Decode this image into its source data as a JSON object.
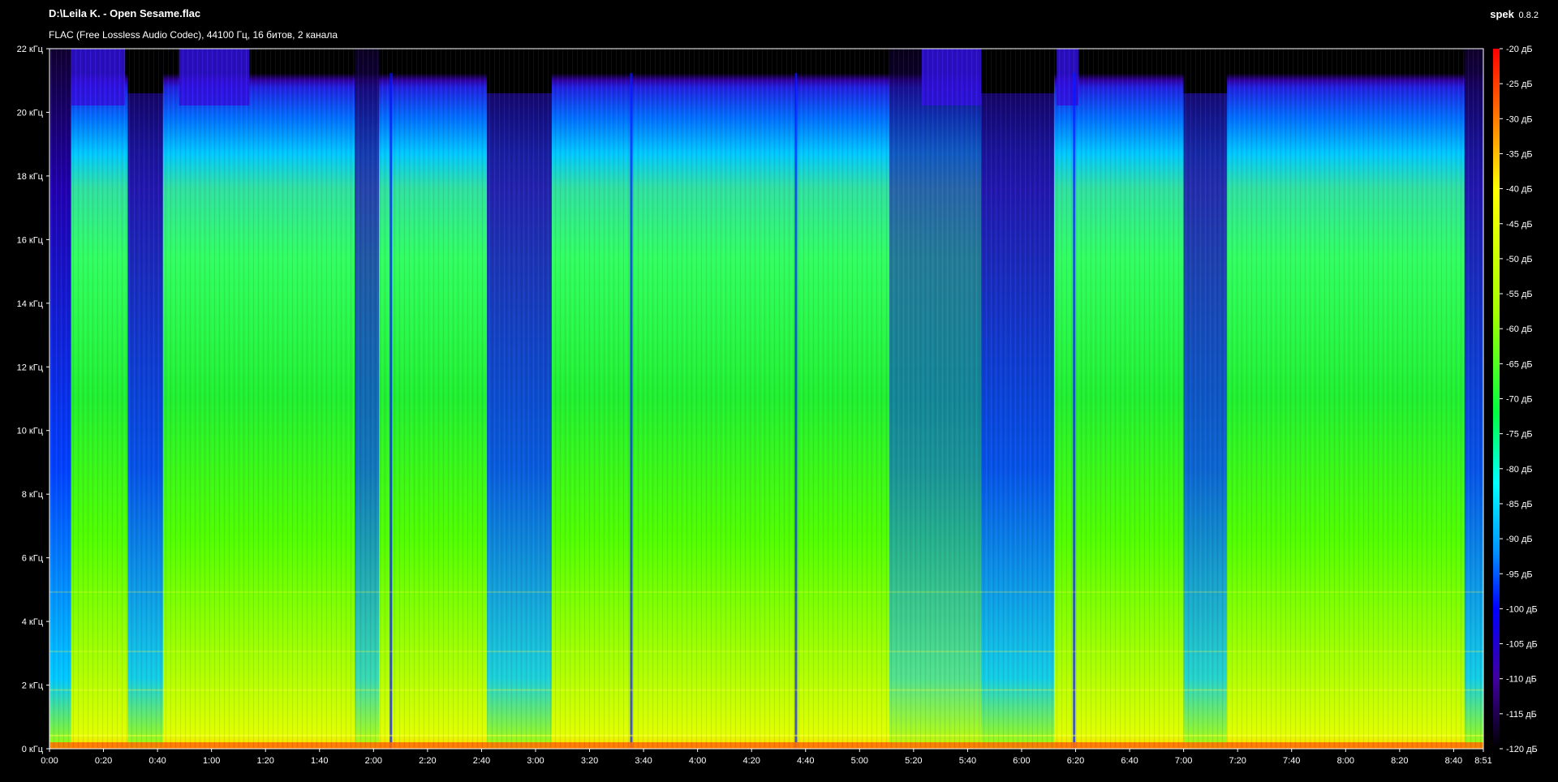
{
  "header": {
    "file_title": "D:\\Leila K. - Open Sesame.flac",
    "file_info": "FLAC (Free Lossless Audio Codec), 44100 Гц, 16 битов, 2 канала",
    "app_name": "spek",
    "app_version": "0.8.2"
  },
  "spectrogram": {
    "frequency_axis_labels": [
      "22 кГц",
      "20 кГц",
      "18 кГц",
      "16 кГц",
      "14 кГц",
      "12 кГц",
      "10 кГц",
      "8 кГц",
      "6 кГц",
      "4 кГц",
      "2 кГц",
      "0 кГц"
    ],
    "time_axis_labels": [
      "0:00",
      "0:20",
      "0:40",
      "1:00",
      "1:20",
      "1:40",
      "2:00",
      "2:20",
      "2:40",
      "3:00",
      "3:20",
      "3:40",
      "4:00",
      "4:20",
      "4:40",
      "5:00",
      "5:20",
      "5:40",
      "6:00",
      "6:20",
      "6:40",
      "7:00",
      "7:20",
      "7:40",
      "8:00",
      "8:20",
      "8:40",
      "8:51"
    ],
    "time_tick_seconds": [
      0,
      20,
      40,
      60,
      80,
      100,
      120,
      140,
      160,
      180,
      200,
      220,
      240,
      260,
      280,
      300,
      320,
      340,
      360,
      380,
      400,
      420,
      440,
      460,
      480,
      500,
      520,
      531
    ],
    "duration_seconds": 531,
    "max_frequency_khz": 22,
    "colors": {
      "background": "#000000",
      "axis": "#ffffff",
      "palette": [
        "#000000",
        "#1a0040",
        "#3a00b0",
        "#0000ff",
        "#0090ff",
        "#00ffff",
        "#00ff60",
        "#60ff00",
        "#c8ff00",
        "#ffff00",
        "#ff8000",
        "#ff0000"
      ]
    }
  },
  "legend": {
    "db_labels": [
      "-20 дБ",
      "-25 дБ",
      "-30 дБ",
      "-35 дБ",
      "-40 дБ",
      "-45 дБ",
      "-50 дБ",
      "-55 дБ",
      "-60 дБ",
      "-65 дБ",
      "-70 дБ",
      "-75 дБ",
      "-80 дБ",
      "-85 дБ",
      "-90 дБ",
      "-95 дБ",
      "-100 дБ",
      "-105 дБ",
      "-110 дБ",
      "-115 дБ",
      "-120 дБ"
    ],
    "db_max": -20,
    "db_min": -120
  }
}
